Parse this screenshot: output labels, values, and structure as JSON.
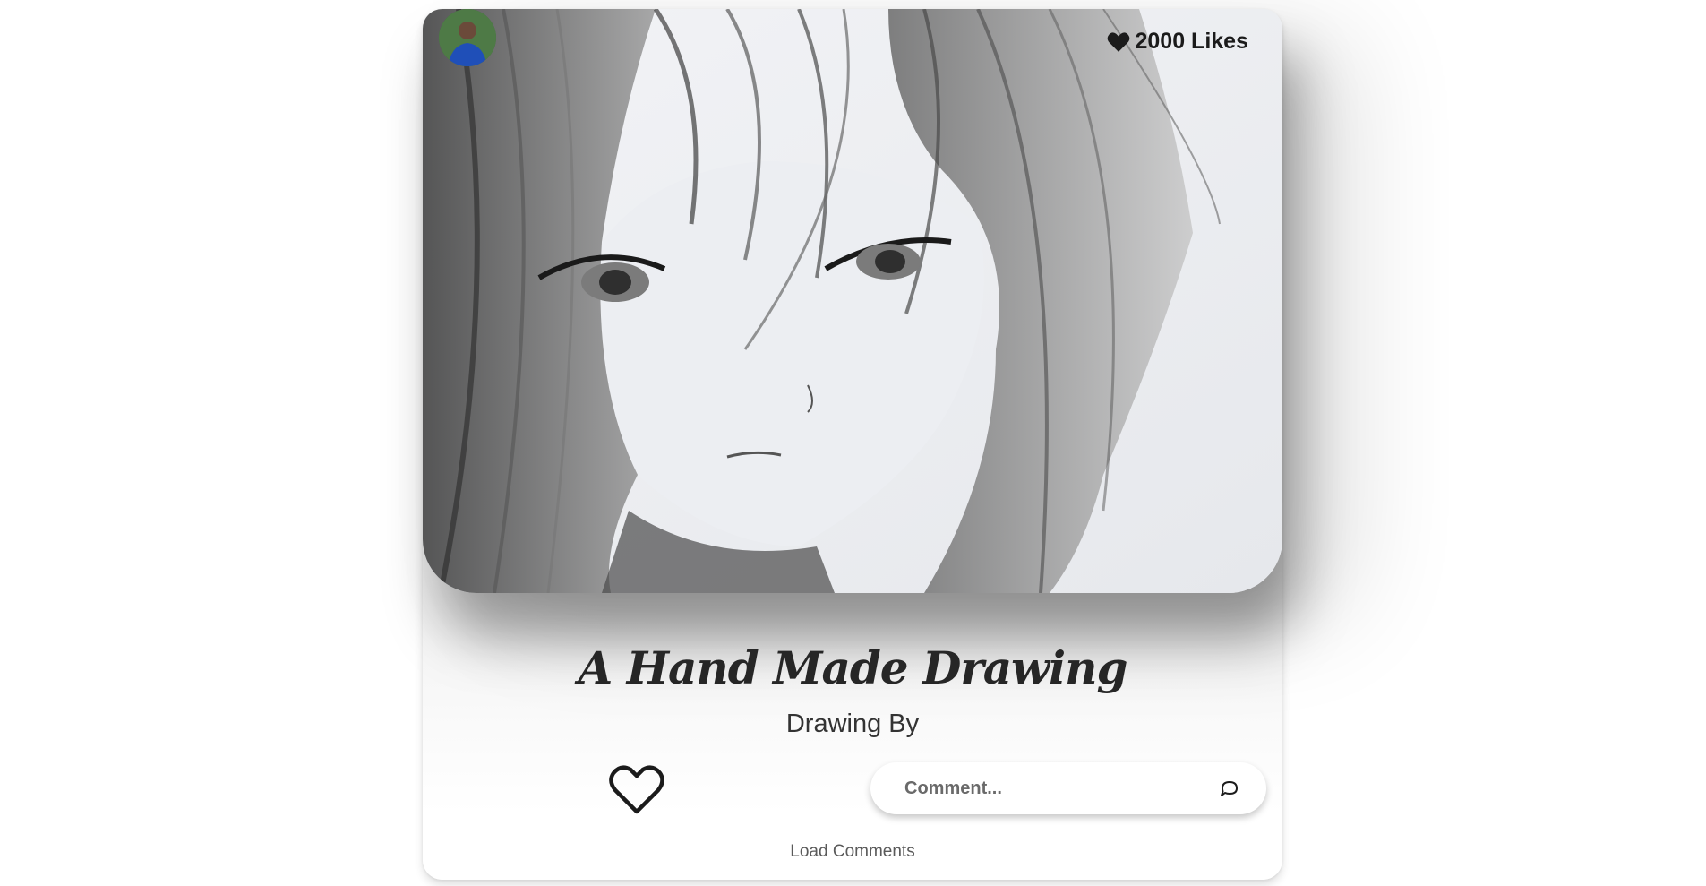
{
  "post": {
    "image_alt": "pencil sketch of an anime girl with long hair",
    "likes_count": "2000 Likes",
    "title": "A Hand Made Drawing",
    "subtitle": "Drawing By",
    "icons": {
      "likes": "heart-filled-icon",
      "like_button": "heart-outline-icon",
      "send": "chat-bubble-icon",
      "avatar": "user-avatar"
    }
  },
  "comment": {
    "placeholder": "Comment...",
    "value": ""
  },
  "actions": {
    "load_comments_label": "Load Comments"
  },
  "colors": {
    "text_dark": "#262626",
    "text_muted": "#5a5a5a",
    "card_bg": "#ffffff"
  }
}
